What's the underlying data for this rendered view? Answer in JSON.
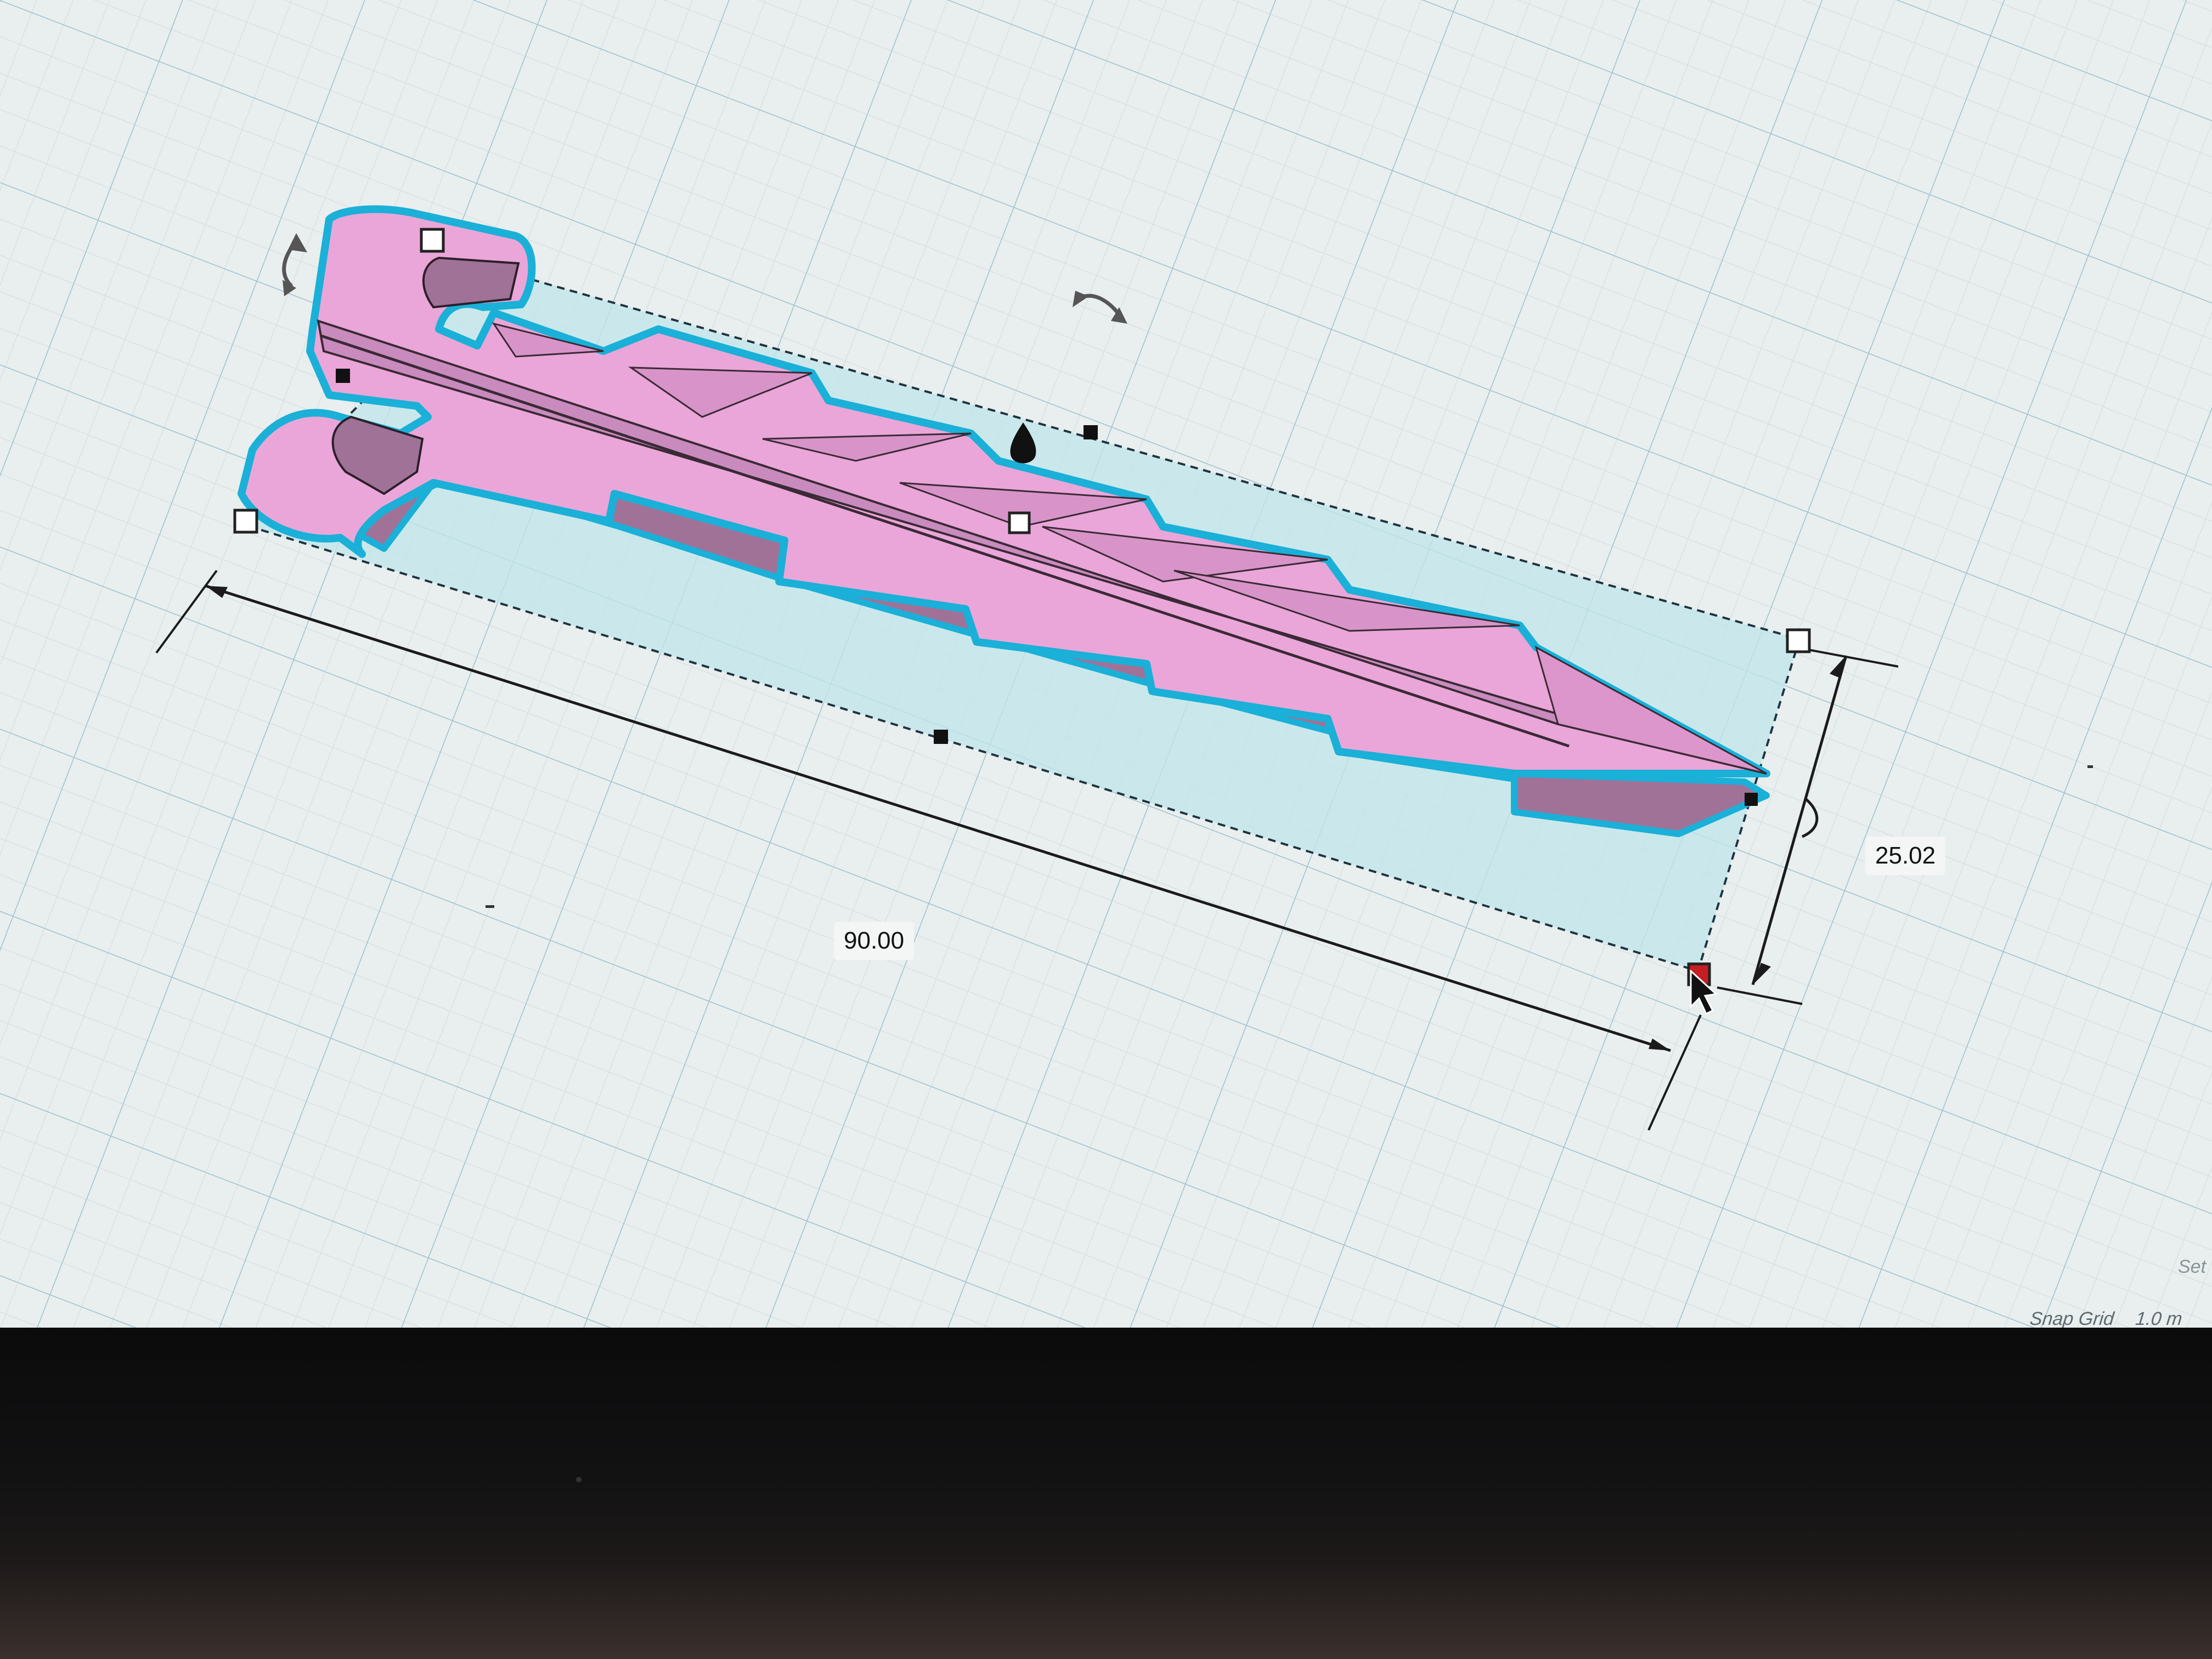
{
  "dimensions": {
    "length": "90.00",
    "width": "25.02"
  },
  "status_bar": {
    "snap_grid_label": "Snap Grid",
    "snap_grid_value": "1.0 m",
    "settings_label": "Set"
  },
  "shape": {
    "color": "#e9a7d6",
    "outline_color": "#1ab0d8",
    "selection_fill": "#bfe6ea"
  },
  "icons": {
    "rotate_left": "rotate-arrow-icon",
    "rotate_top": "rotate-arrow-icon",
    "rotate_right": "rotate-arrow-icon",
    "lift": "drop-icon",
    "cursor": "mouse-pointer-icon"
  }
}
